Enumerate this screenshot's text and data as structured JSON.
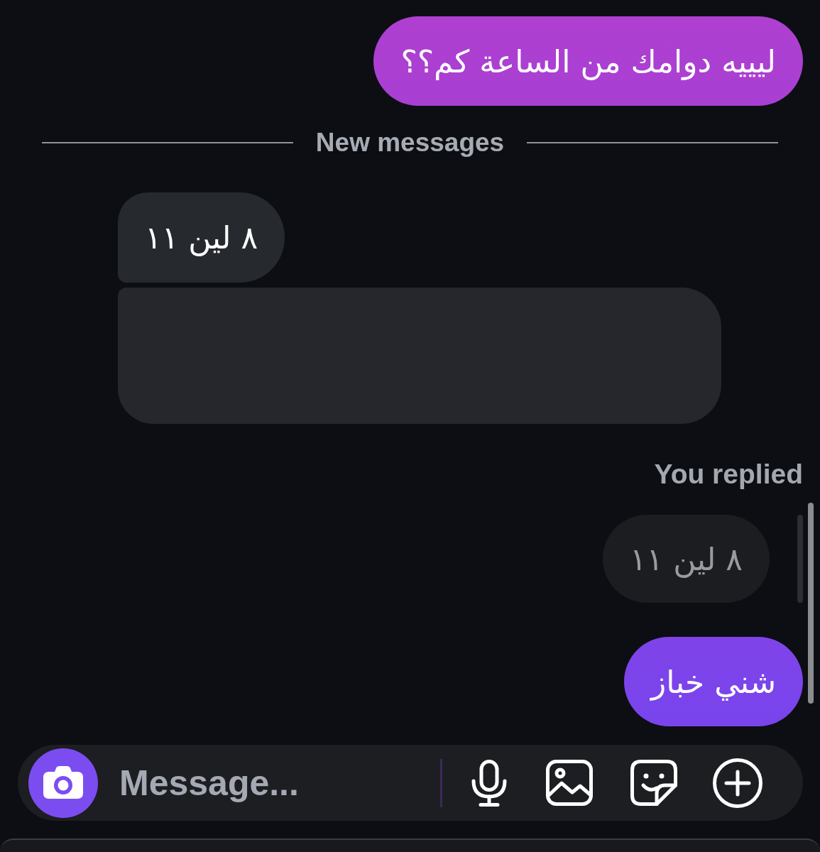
{
  "messages": [
    {
      "kind": "sent",
      "text": "ليييه دوامك من الساعة كم؟؟"
    },
    {
      "kind": "divider",
      "text": "New messages"
    },
    {
      "kind": "received",
      "text": "٨ لين ١١"
    },
    {
      "kind": "redacted"
    },
    {
      "kind": "reply_label",
      "text": "You replied"
    },
    {
      "kind": "quote",
      "text": "٨ لين ١١"
    },
    {
      "kind": "sent",
      "text": "شني خباز"
    }
  ],
  "composer": {
    "placeholder": "Message..."
  }
}
